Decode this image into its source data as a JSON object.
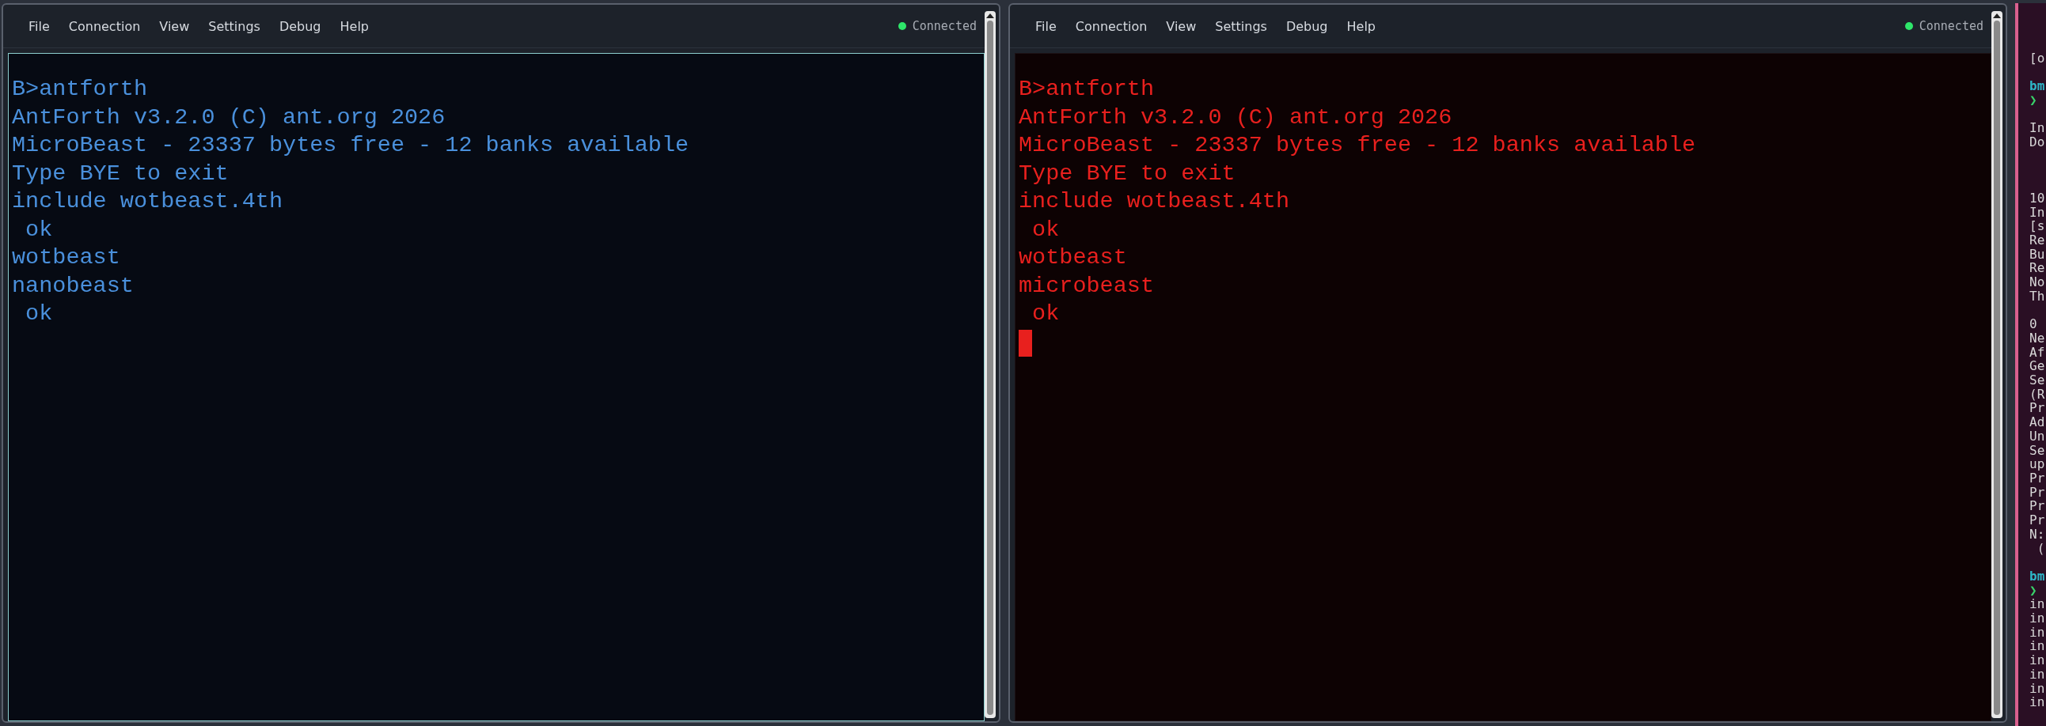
{
  "windows": [
    {
      "menu": [
        "File",
        "Connection",
        "View",
        "Settings",
        "Debug",
        "Help"
      ],
      "status": {
        "label": "Connected",
        "connected": true
      },
      "terminal": {
        "kind": "blue",
        "color": "#4a90dc",
        "cursor": false,
        "lines": [
          "B>antforth",
          "AntForth v3.2.0 (C) ant.org 2026",
          "MicroBeast - 23337 bytes free - 12 banks available",
          "Type BYE to exit",
          "include wotbeast.4th",
          " ok",
          "wotbeast",
          "nanobeast",
          " ok"
        ]
      }
    },
    {
      "menu": [
        "File",
        "Connection",
        "View",
        "Settings",
        "Debug",
        "Help"
      ],
      "status": {
        "label": "Connected",
        "connected": true
      },
      "terminal": {
        "kind": "red",
        "color": "#e8201e",
        "cursor": true,
        "lines": [
          "B>antforth",
          "AntForth v3.2.0 (C) ant.org 2026",
          "MicroBeast - 23337 bytes free - 12 banks available",
          "Type BYE to exit",
          "include wotbeast.4th",
          " ok",
          "wotbeast",
          "microbeast",
          " ok"
        ]
      }
    }
  ],
  "side_terminal": {
    "lines": [
      {
        "kind": "text",
        "text": "[o"
      },
      {
        "kind": "blank"
      },
      {
        "kind": "prompt",
        "text": "bm"
      },
      {
        "kind": "arrow",
        "text": "❯"
      },
      {
        "kind": "blank"
      },
      {
        "kind": "text",
        "text": "In"
      },
      {
        "kind": "text",
        "text": "Do"
      },
      {
        "kind": "blank"
      },
      {
        "kind": "blank"
      },
      {
        "kind": "blank"
      },
      {
        "kind": "text",
        "text": "10"
      },
      {
        "kind": "text",
        "text": "In"
      },
      {
        "kind": "text",
        "text": "[s"
      },
      {
        "kind": "text",
        "text": "Re"
      },
      {
        "kind": "text",
        "text": "Bu"
      },
      {
        "kind": "text",
        "text": "Re"
      },
      {
        "kind": "text",
        "text": "No"
      },
      {
        "kind": "text",
        "text": "Th"
      },
      {
        "kind": "blank"
      },
      {
        "kind": "text",
        "text": "0"
      },
      {
        "kind": "text",
        "text": "Ne"
      },
      {
        "kind": "text",
        "text": "Af"
      },
      {
        "kind": "text",
        "text": "Ge"
      },
      {
        "kind": "text",
        "text": "Se"
      },
      {
        "kind": "text",
        "text": "(R"
      },
      {
        "kind": "text",
        "text": "Pr"
      },
      {
        "kind": "text",
        "text": "Ad"
      },
      {
        "kind": "text",
        "text": "Un"
      },
      {
        "kind": "text",
        "text": "Se"
      },
      {
        "kind": "text",
        "text": "up"
      },
      {
        "kind": "text",
        "text": "Pr"
      },
      {
        "kind": "text",
        "text": "Pr"
      },
      {
        "kind": "text",
        "text": "Pr"
      },
      {
        "kind": "text",
        "text": "Pr"
      },
      {
        "kind": "text",
        "text": "N:"
      },
      {
        "kind": "text",
        "text": " ("
      },
      {
        "kind": "blank"
      },
      {
        "kind": "prompt",
        "text": "bm"
      },
      {
        "kind": "arrow",
        "text": "❯"
      },
      {
        "kind": "text",
        "text": "in"
      },
      {
        "kind": "text",
        "text": "in"
      },
      {
        "kind": "text",
        "text": "in"
      },
      {
        "kind": "text",
        "text": "in"
      },
      {
        "kind": "text",
        "text": "in"
      },
      {
        "kind": "text",
        "text": "in"
      },
      {
        "kind": "text",
        "text": "in"
      },
      {
        "kind": "text",
        "text": "in"
      }
    ]
  }
}
